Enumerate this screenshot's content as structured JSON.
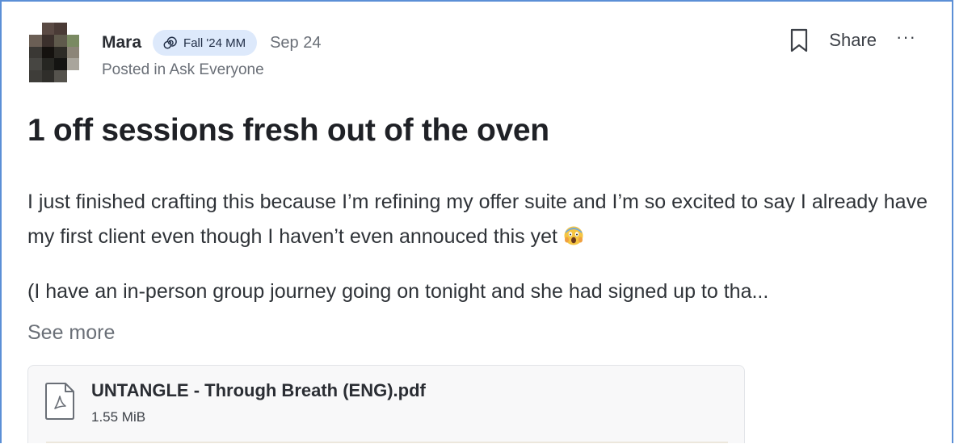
{
  "post": {
    "author": "Mara",
    "badge": "Fall '24 MM",
    "date": "Sep 24",
    "posted_in": "Posted in Ask Everyone",
    "title": "1 off sessions fresh out of the oven",
    "body": "I just finished crafting this because I’m refining my offer suite and I’m so excited to say I already have my first client even though I haven’t even annouced this yet",
    "body_2": "(I have an in-person group journey going on tonight and she had signed up to tha...",
    "see_more": "See more"
  },
  "actions": {
    "bookmark_icon": "bookmark-icon",
    "share_label": "Share",
    "more_label": "···"
  },
  "attachment": {
    "file_name": "UNTANGLE - Through Breath (ENG).pdf",
    "file_size": "1.55 MiB",
    "icon": "pdf-file-icon"
  },
  "colors": {
    "frame": "#5b8fd6",
    "badge_bg": "#dde9fb",
    "muted_text": "#6a6f77"
  }
}
